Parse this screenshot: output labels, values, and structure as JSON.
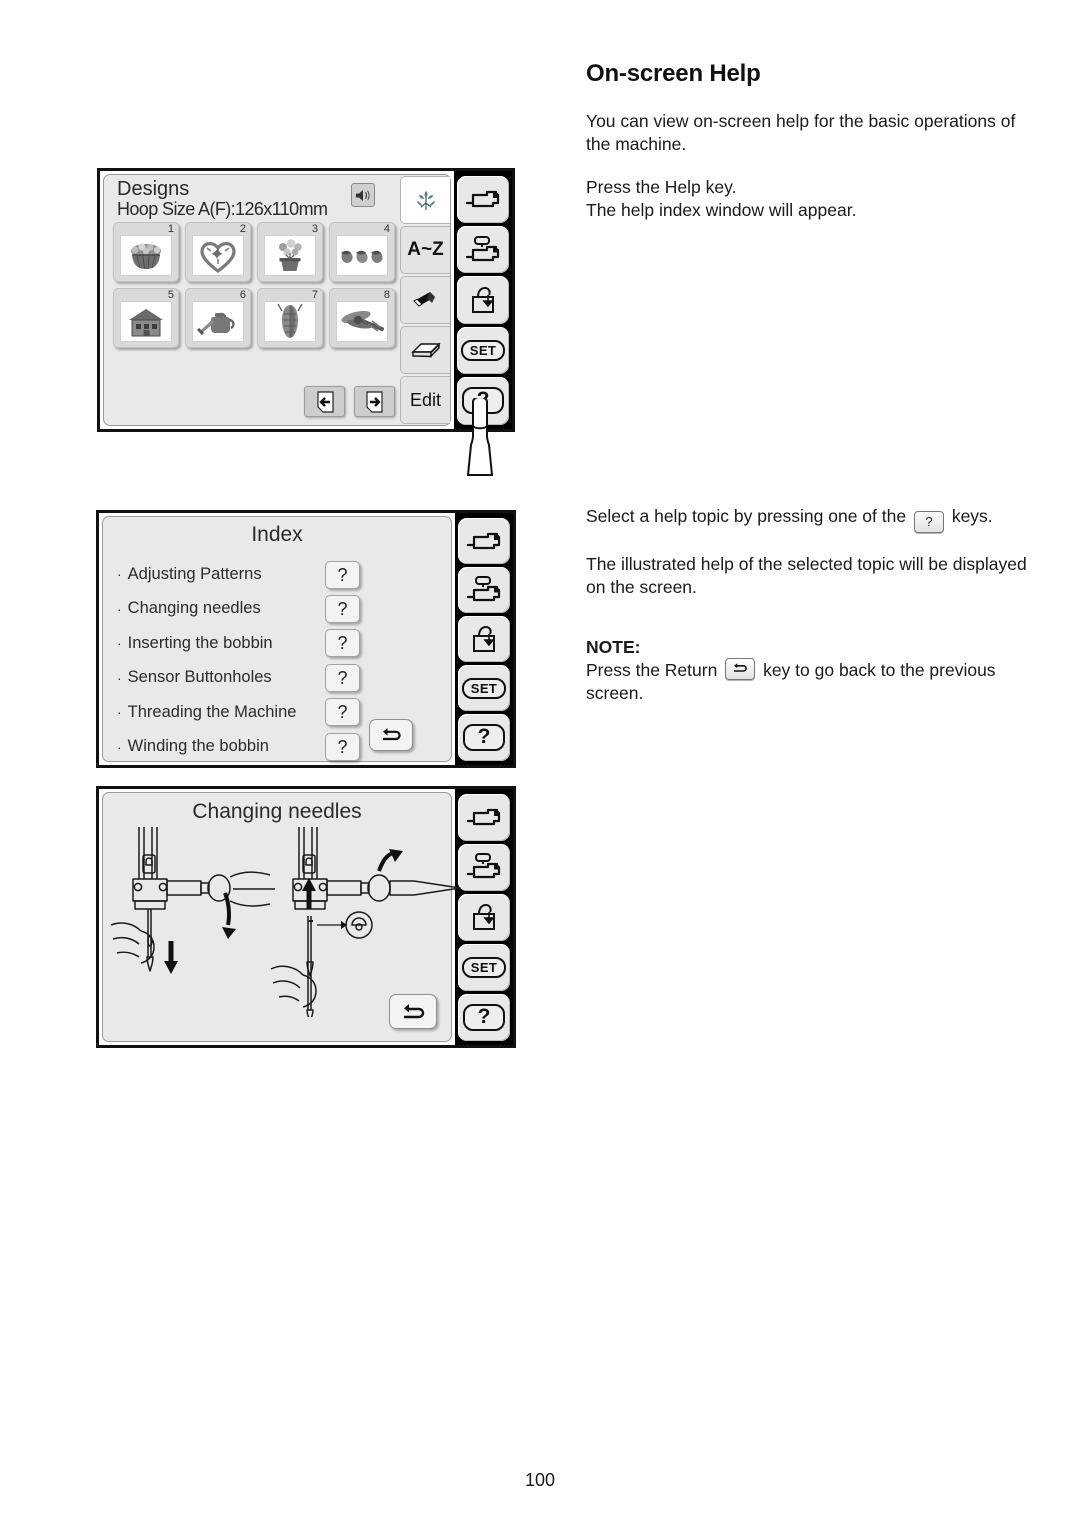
{
  "page_number": "100",
  "heading": "On-screen Help",
  "paragraphs": {
    "intro": "You can view on-screen help for the basic operations of the machine.",
    "press_help": "Press the Help key.",
    "help_index": "The help index window will appear.",
    "select_topic_before": "Select a help topic by pressing one of the",
    "select_topic_after": "keys.",
    "illustrated_help": "The illustrated help of the selected topic will be displayed on the screen.",
    "note_label": "NOTE:",
    "note_before": "Press the Return",
    "note_after": "key to go back to the previous screen."
  },
  "inline_keys": {
    "help_key": "?",
    "return_key": "return-arrow"
  },
  "designs_screen": {
    "title": "Designs",
    "subtitle": "Hoop Size A(F):126x110mm",
    "speaker_icon": "speaker-icon",
    "designs": [
      {
        "number": "1",
        "icon": "flower-basket"
      },
      {
        "number": "2",
        "icon": "heart-wreath"
      },
      {
        "number": "3",
        "icon": "potted-flowers"
      },
      {
        "number": "4",
        "icon": "three-acorns"
      },
      {
        "number": "5",
        "icon": "house"
      },
      {
        "number": "6",
        "icon": "watering-can"
      },
      {
        "number": "7",
        "icon": "corn-cob"
      },
      {
        "number": "8",
        "icon": "dragonfly"
      }
    ],
    "nav": {
      "prev": "page-left-arrow",
      "next": "page-right-arrow"
    },
    "tabs": [
      {
        "label": "",
        "icon": "flower-design-tab",
        "selected": true
      },
      {
        "label": "A~Z",
        "icon": "",
        "selected": false
      },
      {
        "label": "",
        "icon": "eraser-icon",
        "selected": false
      },
      {
        "label": "",
        "icon": "box-icon",
        "selected": false
      },
      {
        "label": "Edit",
        "icon": "",
        "selected": false
      }
    ]
  },
  "index_screen": {
    "title": "Index",
    "bullet": "·",
    "topics": [
      {
        "label": "Adjusting Patterns",
        "key": "?"
      },
      {
        "label": "Changing needles",
        "key": "?"
      },
      {
        "label": "Inserting the bobbin",
        "key": "?"
      },
      {
        "label": "Sensor Buttonholes",
        "key": "?"
      },
      {
        "label": "Threading the Machine",
        "key": "?"
      },
      {
        "label": "Winding the bobbin",
        "key": "?"
      }
    ],
    "return_button": "return-arrow"
  },
  "needle_screen": {
    "title": "Changing needles",
    "return_button": "return-arrow"
  },
  "side_panel": {
    "buttons": [
      {
        "name": "sewing-machine-icon",
        "label": ""
      },
      {
        "name": "embroidery-machine-icon",
        "label": ""
      },
      {
        "name": "bag-arrow-icon",
        "label": ""
      },
      {
        "name": "set-button",
        "label": "SET"
      },
      {
        "name": "help-button",
        "label": "?"
      }
    ]
  },
  "colors": {
    "text": "#1a1a1a",
    "lcd_bg": "#e9e9e9",
    "bezel": "#000000",
    "button": "#e8e8e8"
  }
}
